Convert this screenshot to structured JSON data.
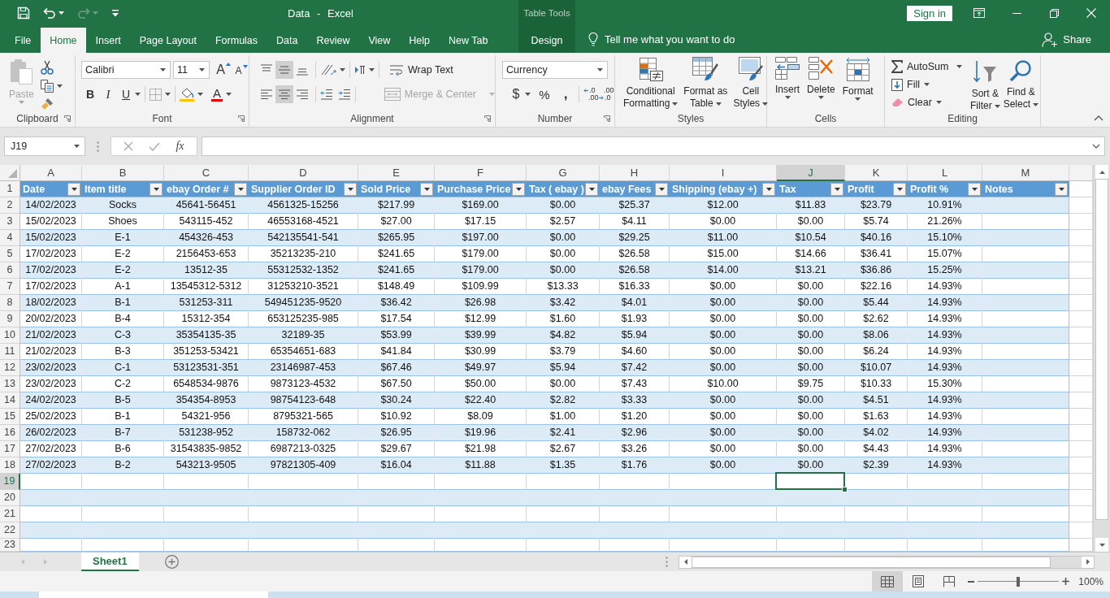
{
  "title_bar": {
    "title": "Data - Excel",
    "sign_in": "Sign in"
  },
  "tabs": [
    {
      "label": "File",
      "selected": false
    },
    {
      "label": "Home",
      "selected": true
    },
    {
      "label": "Insert",
      "selected": false
    },
    {
      "label": "Page Layout",
      "selected": false
    },
    {
      "label": "Formulas",
      "selected": false
    },
    {
      "label": "Data",
      "selected": false
    },
    {
      "label": "Review",
      "selected": false
    },
    {
      "label": "View",
      "selected": false
    },
    {
      "label": "Help",
      "selected": false
    },
    {
      "label": "New Tab",
      "selected": false
    }
  ],
  "contextual": {
    "label": "Table Tools",
    "tab": {
      "label": "Design",
      "selected": false
    }
  },
  "tell_me": {
    "placeholder": "Tell me what you want to do"
  },
  "share": {
    "label": "Share"
  },
  "ribbon": {
    "groups": [
      {
        "kind": "clipboard",
        "label": "Clipboard",
        "launcher": true,
        "paste": {
          "label": "Paste",
          "disabled": true
        }
      },
      {
        "kind": "font",
        "label": "Font",
        "launcher": true,
        "font_name": "Calibri",
        "font_size": "11",
        "grow": "A",
        "shrink": "A",
        "bold": "B",
        "italic": "I",
        "underline": "U",
        "font_color": "A"
      },
      {
        "kind": "alignment",
        "label": "Alignment",
        "launcher": true,
        "vertical": [
          {
            "selected": false
          },
          {
            "selected": true
          },
          {
            "selected": false
          }
        ],
        "horizontal": [
          {
            "selected": false
          },
          {
            "selected": true
          },
          {
            "selected": false
          }
        ],
        "wrap_text": "Wrap Text",
        "merge": {
          "label": "Merge & Center",
          "disabled": true
        }
      },
      {
        "kind": "number",
        "label": "Number",
        "launcher": true,
        "format": "Currency",
        "currency": "$",
        "percent": "%",
        "comma": ",",
        "decimals": [
          {
            "kind": "increase",
            "upper": ".0",
            "lower": ".00"
          },
          {
            "kind": "decrease",
            "upper": ".00",
            "lower": ".0"
          }
        ]
      },
      {
        "kind": "styles",
        "label": "Styles",
        "launcher": false,
        "buttons": [
          {
            "kind": "conditional",
            "label": "Conditional Formatting"
          },
          {
            "kind": "table",
            "label": "Format as Table"
          },
          {
            "kind": "cell_styles",
            "label": "Cell Styles"
          }
        ]
      },
      {
        "kind": "cells",
        "label": "Cells",
        "launcher": false,
        "buttons": [
          {
            "kind": "insert",
            "label": "Insert"
          },
          {
            "kind": "delete",
            "label": "Delete"
          },
          {
            "kind": "format",
            "label": "Format"
          }
        ]
      },
      {
        "kind": "editing",
        "label": "Editing",
        "launcher": false,
        "small": [
          {
            "kind": "autosum",
            "label": "AutoSum"
          },
          {
            "kind": "fill",
            "label": "Fill"
          },
          {
            "kind": "clear",
            "label": "Clear"
          }
        ],
        "large": [
          {
            "kind": "sort",
            "label": "Sort & Filter"
          },
          {
            "kind": "find",
            "label": "Find & Select"
          }
        ]
      }
    ]
  },
  "formula_bar": {
    "name_box": "J19",
    "function_button": "fx"
  },
  "sheet": {
    "columns": [
      {
        "label": "A",
        "selected": false
      },
      {
        "label": "B",
        "selected": false
      },
      {
        "label": "C",
        "selected": false
      },
      {
        "label": "D",
        "selected": false
      },
      {
        "label": "E",
        "selected": false
      },
      {
        "label": "F",
        "selected": false
      },
      {
        "label": "G",
        "selected": false
      },
      {
        "label": "H",
        "selected": false
      },
      {
        "label": "I",
        "selected": false
      },
      {
        "label": "J",
        "selected": true
      },
      {
        "label": "K",
        "selected": false
      },
      {
        "label": "L",
        "selected": false
      },
      {
        "label": "M",
        "selected": false
      }
    ],
    "rows": [
      {
        "label": "1",
        "selected": false
      },
      {
        "label": "2",
        "selected": false
      },
      {
        "label": "3",
        "selected": false
      },
      {
        "label": "4",
        "selected": false
      },
      {
        "label": "5",
        "selected": false
      },
      {
        "label": "6",
        "selected": false
      },
      {
        "label": "7",
        "selected": false
      },
      {
        "label": "8",
        "selected": false
      },
      {
        "label": "9",
        "selected": false
      },
      {
        "label": "10",
        "selected": false
      },
      {
        "label": "11",
        "selected": false
      },
      {
        "label": "12",
        "selected": false
      },
      {
        "label": "13",
        "selected": false
      },
      {
        "label": "14",
        "selected": false
      },
      {
        "label": "15",
        "selected": false
      },
      {
        "label": "16",
        "selected": false
      },
      {
        "label": "17",
        "selected": false
      },
      {
        "label": "18",
        "selected": false
      },
      {
        "label": "19",
        "selected": true
      },
      {
        "label": "20",
        "selected": false
      },
      {
        "label": "21",
        "selected": false
      },
      {
        "label": "22",
        "selected": false
      },
      {
        "label": "23",
        "selected": false
      }
    ],
    "table": {
      "headers": [
        "Date",
        "Item title",
        "ebay Order #",
        "Supplier Order ID",
        "Sold Price",
        "Purchase Price",
        "Tax ( ebay )",
        "ebay Fees",
        "Shipping (ebay +)",
        "Tax",
        "Profit",
        "Profit %",
        "Notes"
      ],
      "rows": [
        [
          "14/02/2023",
          "Socks",
          "45641-56451",
          "4561325-15256",
          "$217.99",
          "$169.00",
          "$0.00",
          "$25.37",
          "$12.00",
          "$11.83",
          "$23.79",
          "10.91%"
        ],
        [
          "15/02/2023",
          "Shoes",
          "543115-452",
          "46553168-4521",
          "$27.00",
          "$17.15",
          "$2.57",
          "$4.11",
          "$0.00",
          "$0.00",
          "$5.74",
          "21.26%"
        ],
        [
          "15/02/2023",
          "E-1",
          "454326-453",
          "542135541-541",
          "$265.95",
          "$197.00",
          "$0.00",
          "$29.25",
          "$11.00",
          "$10.54",
          "$40.16",
          "15.10%"
        ],
        [
          "17/02/2023",
          "E-2",
          "2156453-653",
          "35213235-210",
          "$241.65",
          "$179.00",
          "$0.00",
          "$26.58",
          "$15.00",
          "$14.66",
          "$36.41",
          "15.07%"
        ],
        [
          "17/02/2023",
          "E-2",
          "13512-35",
          "55312532-1352",
          "$241.65",
          "$179.00",
          "$0.00",
          "$26.58",
          "$14.00",
          "$13.21",
          "$36.86",
          "15.25%"
        ],
        [
          "17/02/2023",
          "A-1",
          "13545312-5312",
          "31253210-3521",
          "$148.49",
          "$109.99",
          "$13.33",
          "$16.33",
          "$0.00",
          "$0.00",
          "$22.16",
          "14.93%"
        ],
        [
          "18/02/2023",
          "B-1",
          "531253-311",
          "549451235-9520",
          "$36.42",
          "$26.98",
          "$3.42",
          "$4.01",
          "$0.00",
          "$0.00",
          "$5.44",
          "14.93%"
        ],
        [
          "20/02/2023",
          "B-4",
          "15312-354",
          "653125235-985",
          "$17.54",
          "$12.99",
          "$1.60",
          "$1.93",
          "$0.00",
          "$0.00",
          "$2.62",
          "14.93%"
        ],
        [
          "21/02/2023",
          "C-3",
          "35354135-35",
          "32189-35",
          "$53.99",
          "$39.99",
          "$4.82",
          "$5.94",
          "$0.00",
          "$0.00",
          "$8.06",
          "14.93%"
        ],
        [
          "21/02/2023",
          "B-3",
          "351253-53421",
          "65354651-683",
          "$41.84",
          "$30.99",
          "$3.79",
          "$4.60",
          "$0.00",
          "$0.00",
          "$6.24",
          "14.93%"
        ],
        [
          "23/02/2023",
          "C-1",
          "53123531-351",
          "23146987-453",
          "$67.46",
          "$49.97",
          "$5.94",
          "$7.42",
          "$0.00",
          "$0.00",
          "$10.07",
          "14.93%"
        ],
        [
          "23/02/2023",
          "C-2",
          "6548534-9876",
          "9873123-4532",
          "$67.50",
          "$50.00",
          "$0.00",
          "$7.43",
          "$10.00",
          "$9.75",
          "$10.33",
          "15.30%"
        ],
        [
          "24/02/2023",
          "B-5",
          "354354-8953",
          "98754123-648",
          "$30.24",
          "$22.40",
          "$2.82",
          "$3.33",
          "$0.00",
          "$0.00",
          "$4.51",
          "14.93%"
        ],
        [
          "25/02/2023",
          "B-1",
          "54321-956",
          "8795321-565",
          "$10.92",
          "$8.09",
          "$1.00",
          "$1.20",
          "$0.00",
          "$0.00",
          "$1.63",
          "14.93%"
        ],
        [
          "26/02/2023",
          "B-7",
          "531238-952",
          "158732-062",
          "$26.95",
          "$19.96",
          "$2.41",
          "$2.96",
          "$0.00",
          "$0.00",
          "$4.02",
          "14.93%"
        ],
        [
          "27/02/2023",
          "B-6",
          "31543835-9852",
          "6987213-0325",
          "$29.67",
          "$21.98",
          "$2.67",
          "$3.26",
          "$0.00",
          "$0.00",
          "$4.43",
          "14.93%"
        ],
        [
          "27/02/2023",
          "B-2",
          "543213-9505",
          "97821305-409",
          "$16.04",
          "$11.88",
          "$1.35",
          "$1.76",
          "$0.00",
          "$0.00",
          "$2.39",
          "14.93%"
        ]
      ]
    }
  },
  "sheet_tabs": [
    {
      "label": "Sheet1",
      "selected": true
    }
  ],
  "status_bar": {
    "views": [
      {
        "kind": "normal",
        "selected": true
      },
      {
        "kind": "page_layout",
        "selected": false
      },
      {
        "kind": "page_break",
        "selected": false
      }
    ],
    "zoom": {
      "level": 0.5,
      "reading": "100%"
    }
  }
}
